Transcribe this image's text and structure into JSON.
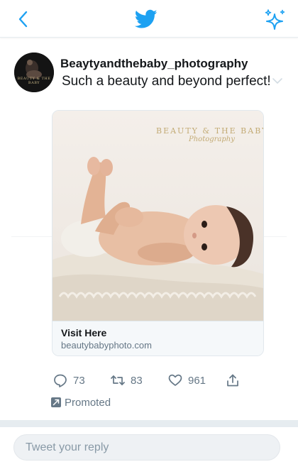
{
  "header": {
    "back_icon": "chevron-left-icon",
    "logo_icon": "twitter-bird-icon",
    "action_icon": "sparkle-icon",
    "accent": "#1da1f2"
  },
  "tweet": {
    "avatar_text": "BEAUTY & THE BABY",
    "username": "Beaytyandthebaby_photography",
    "text": "Such a beauty and beyond perfect!",
    "menu_icon": "chevron-down-icon"
  },
  "card": {
    "image_brand": "BEAUTY & THE BABY",
    "image_brand_sub": "Photography",
    "title": "Visit Here",
    "domain": "beautybabyphoto.com"
  },
  "actions": {
    "reply_count": "73",
    "retweet_count": "83",
    "like_count": "961"
  },
  "promoted": {
    "label": "Promoted"
  },
  "reply_box": {
    "placeholder": "Tweet your reply"
  }
}
